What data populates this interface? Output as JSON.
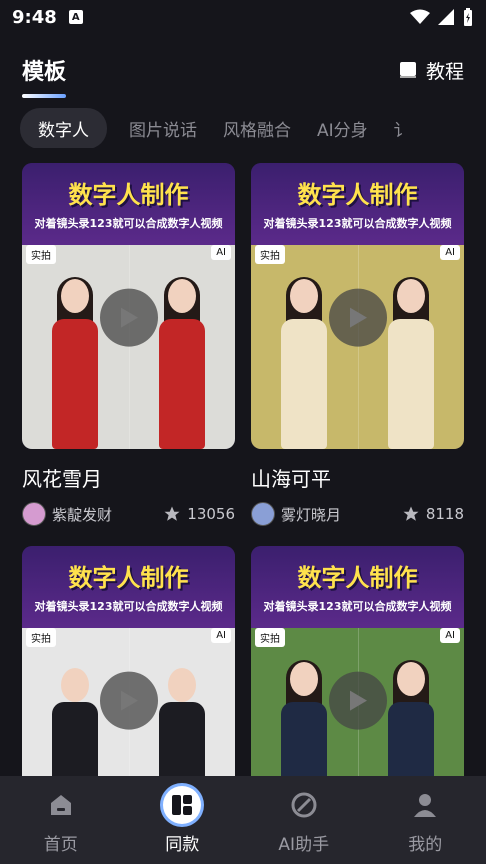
{
  "status": {
    "time": "9:48",
    "notif": "A"
  },
  "header": {
    "title": "模板",
    "tutorial_label": "教程"
  },
  "tabs": [
    {
      "label": "数字人",
      "active": true
    },
    {
      "label": "图片说话"
    },
    {
      "label": "风格融合"
    },
    {
      "label": "AI分身"
    },
    {
      "label": "讠"
    }
  ],
  "cards": [
    {
      "banner_title": "数字人制作",
      "banner_sub": "对着镜头录123就可以合成数字人视频",
      "badge_left": "实拍",
      "badge_right": "AI",
      "title": "风花雪月",
      "author": "紫靛发财",
      "likes": "13056",
      "bg": "#dcdcd8",
      "dress": "#c22626"
    },
    {
      "banner_title": "数字人制作",
      "banner_sub": "对着镜头录123就可以合成数字人视频",
      "badge_left": "实拍",
      "badge_right": "AI",
      "title": "山海可平",
      "author": "雾灯晓月",
      "likes": "8118",
      "bg": "#c7b86a",
      "dress": "#efe3c6"
    },
    {
      "banner_title": "数字人制作",
      "banner_sub": "对着镜头录123就可以合成数字人视频",
      "badge_left": "实拍",
      "badge_right": "AI",
      "title": "",
      "author": "",
      "likes": "",
      "bg": "#e6e6e6",
      "dress": "#1c1c22"
    },
    {
      "banner_title": "数字人制作",
      "banner_sub": "对着镜头录123就可以合成数字人视频",
      "badge_left": "实拍",
      "badge_right": "AI",
      "title": "",
      "author": "",
      "likes": "",
      "bg": "#5d8a45",
      "dress": "#1f2a44"
    }
  ],
  "nav": [
    {
      "label": "首页",
      "icon": "home-icon"
    },
    {
      "label": "同款",
      "icon": "template-icon",
      "active": true
    },
    {
      "label": "AI助手",
      "icon": "compass-icon"
    },
    {
      "label": "我的",
      "icon": "user-icon"
    }
  ]
}
